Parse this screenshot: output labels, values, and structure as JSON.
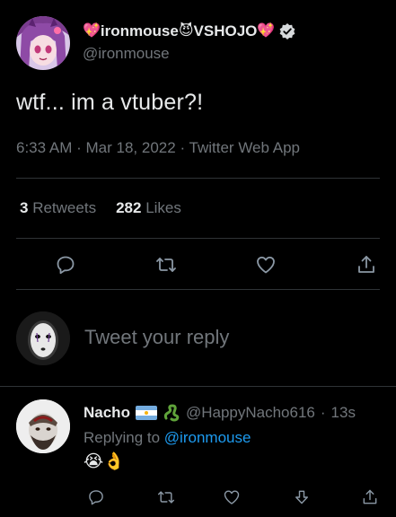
{
  "author": {
    "display_name_prefix_emoji": "💖",
    "display_name_part1": "ironmouse",
    "display_name_mid_emoji": "😈",
    "display_name_part2": "VSHOJO",
    "display_name_suffix_emoji": "💖",
    "handle": "@ironmouse",
    "verified": true
  },
  "tweet": {
    "text": "wtf... im a vtuber?!",
    "time": "6:33 AM",
    "date": "Mar 18, 2022",
    "source": "Twitter Web App",
    "sep": "·"
  },
  "stats": {
    "retweets_count": "3",
    "retweets_label": "Retweets",
    "likes_count": "282",
    "likes_label": "Likes"
  },
  "reply_box": {
    "placeholder": "Tweet your reply"
  },
  "reply": {
    "name": "Nacho",
    "handle": "@HappyNacho616",
    "time": "13s",
    "sep": "·",
    "replying_prefix": "Replying to",
    "replying_to": "@ironmouse",
    "emojis": "😭👌"
  },
  "colors": {
    "background": "#000000",
    "text": "#e7e9ea",
    "muted": "#71767b",
    "link": "#1d9bf0",
    "divider": "#2f3336"
  },
  "icons": [
    "reply-icon",
    "retweet-icon",
    "like-icon",
    "share-icon",
    "downvote-icon",
    "verified-icon"
  ]
}
